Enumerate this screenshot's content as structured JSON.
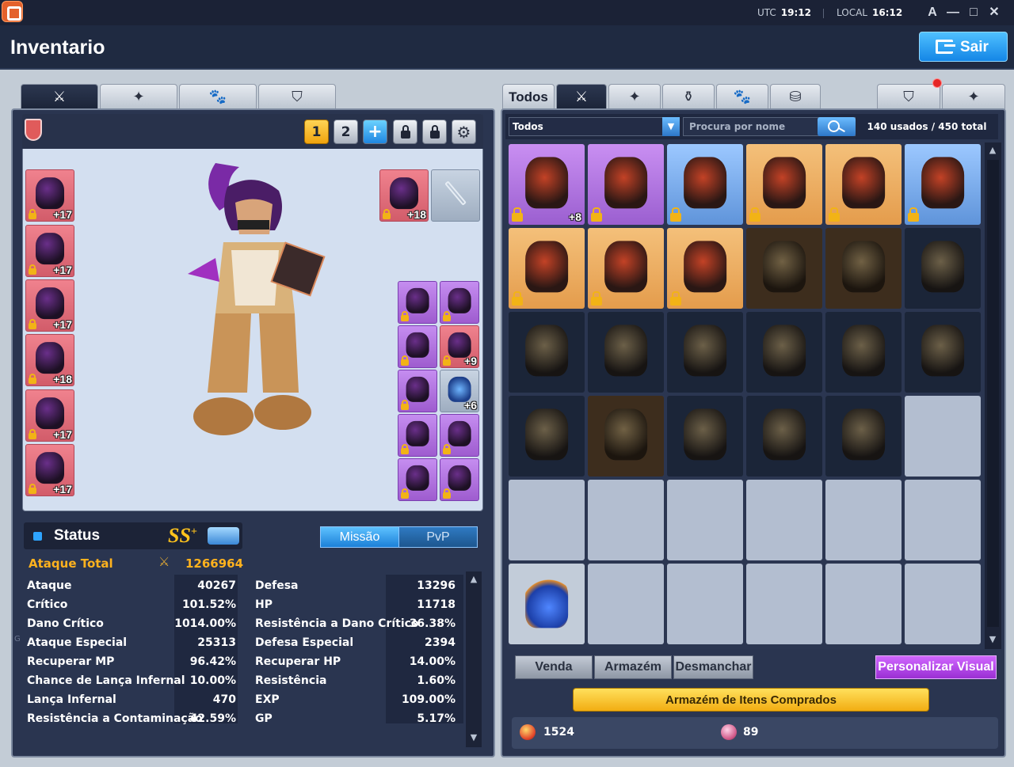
{
  "window": {
    "utc_label": "UTC",
    "utc_time": "19:12",
    "local_label": "LOCAL",
    "local_time": "16:12",
    "font_btn": "A",
    "minimize": "—",
    "maximize": "□",
    "close": "✕"
  },
  "header": {
    "title": "Inventario",
    "exit_label": "Sair"
  },
  "left_tabs": [
    {
      "icon": "swords-icon",
      "glyph": "⚔"
    },
    {
      "icon": "armor-icon",
      "glyph": "✦"
    },
    {
      "icon": "paw-icon",
      "glyph": "🐾"
    },
    {
      "icon": "shield-icon",
      "glyph": "⛉"
    }
  ],
  "char_bar": {
    "slot1": "1",
    "slot2": "2",
    "add": "+",
    "gear": "⚙"
  },
  "left_equipment": [
    {
      "plus": "+17"
    },
    {
      "plus": "+17"
    },
    {
      "plus": "+17"
    },
    {
      "plus": "+18"
    },
    {
      "plus": "+17"
    },
    {
      "plus": "+17"
    }
  ],
  "top_right_equipment": [
    {
      "plus": "+18"
    },
    {
      "plus": ""
    }
  ],
  "accessory_equipment": [
    {
      "plus": ""
    },
    {
      "plus": ""
    },
    {
      "plus": ""
    },
    {
      "plus": "+9"
    },
    {
      "plus": ""
    },
    {
      "plus": "+6"
    },
    {
      "plus": ""
    },
    {
      "plus": ""
    },
    {
      "plus": ""
    },
    {
      "plus": ""
    }
  ],
  "status": {
    "title": "Status",
    "grade": "SS",
    "grade_sup": "+",
    "mode_mission": "Missão",
    "mode_pvp": "PvP",
    "total_label": "Ataque Total",
    "total_value": "1266964",
    "left_stats": [
      {
        "label": "Ataque",
        "value": "40267"
      },
      {
        "label": "Crítico",
        "value": "101.52%"
      },
      {
        "label": "Dano Crítico",
        "value": "1014.00%"
      },
      {
        "label": "Ataque Especial",
        "value": "25313"
      },
      {
        "label": "Recuperar MP",
        "value": "96.42%"
      },
      {
        "label": "Chance de Lança Infernal",
        "value": "10.00%"
      },
      {
        "label": "Lança Infernal",
        "value": "470"
      },
      {
        "label": "Resistência a Contaminação",
        "value": "42.59%"
      }
    ],
    "right_stats": [
      {
        "label": "Defesa",
        "value": "13296"
      },
      {
        "label": "HP",
        "value": "11718"
      },
      {
        "label": "Resistência a Dano Crítico",
        "value": "36.38%"
      },
      {
        "label": "Defesa Especial",
        "value": "2394"
      },
      {
        "label": "Recuperar HP",
        "value": "14.00%"
      },
      {
        "label": "Resistência",
        "value": "1.60%"
      },
      {
        "label": "EXP",
        "value": "109.00%"
      },
      {
        "label": "GP",
        "value": "5.17%"
      }
    ]
  },
  "inventory": {
    "tab_all": "Todos",
    "filter": "Todos",
    "search_placeholder": "Procura por nome",
    "usage": "140 usados / 450 total",
    "items": [
      {
        "rarity": "purple",
        "locked": true,
        "plus": "+8"
      },
      {
        "rarity": "purple",
        "locked": true,
        "plus": ""
      },
      {
        "rarity": "blue",
        "locked": true,
        "plus": ""
      },
      {
        "rarity": "orange",
        "locked": true,
        "plus": ""
      },
      {
        "rarity": "orange",
        "locked": true,
        "plus": ""
      },
      {
        "rarity": "blue",
        "locked": true,
        "plus": ""
      },
      {
        "rarity": "orange",
        "locked": true,
        "plus": ""
      },
      {
        "rarity": "orange",
        "locked": true,
        "plus": ""
      },
      {
        "rarity": "orange",
        "locked": true,
        "plus": ""
      },
      {
        "rarity": "brown",
        "locked": false,
        "plus": ""
      },
      {
        "rarity": "brown",
        "locked": false,
        "plus": ""
      },
      {
        "rarity": "dark",
        "locked": false,
        "plus": ""
      },
      {
        "rarity": "dark",
        "locked": false,
        "plus": ""
      },
      {
        "rarity": "dark",
        "locked": false,
        "plus": ""
      },
      {
        "rarity": "dark",
        "locked": false,
        "plus": ""
      },
      {
        "rarity": "dark",
        "locked": false,
        "plus": ""
      },
      {
        "rarity": "dark",
        "locked": false,
        "plus": ""
      },
      {
        "rarity": "dark",
        "locked": false,
        "plus": ""
      },
      {
        "rarity": "dark",
        "locked": false,
        "plus": ""
      },
      {
        "rarity": "brown",
        "locked": false,
        "plus": ""
      },
      {
        "rarity": "dark",
        "locked": false,
        "plus": ""
      },
      {
        "rarity": "dark",
        "locked": false,
        "plus": ""
      },
      {
        "rarity": "dark",
        "locked": false,
        "plus": ""
      },
      {
        "rarity": "empty",
        "locked": false,
        "plus": ""
      },
      {
        "rarity": "empty"
      },
      {
        "rarity": "empty"
      },
      {
        "rarity": "empty"
      },
      {
        "rarity": "empty"
      },
      {
        "rarity": "empty"
      },
      {
        "rarity": "empty"
      },
      {
        "rarity": "light"
      },
      {
        "rarity": "empty"
      },
      {
        "rarity": "empty"
      },
      {
        "rarity": "empty"
      },
      {
        "rarity": "empty"
      },
      {
        "rarity": "empty"
      }
    ],
    "btn_sell": "Venda",
    "btn_storage": "Armazém",
    "btn_dismantle": "Desmanchar",
    "btn_visual": "Personalizar Visual",
    "btn_bought": "Armazém de Itens Comprados",
    "currency_gem": "1524",
    "currency_coin": "89"
  },
  "misc": {
    "g_mark": "G"
  },
  "colors": {
    "accent_blue": "#1a8be8",
    "gold": "#ffb21e",
    "purple_btn": "#b043e6"
  }
}
